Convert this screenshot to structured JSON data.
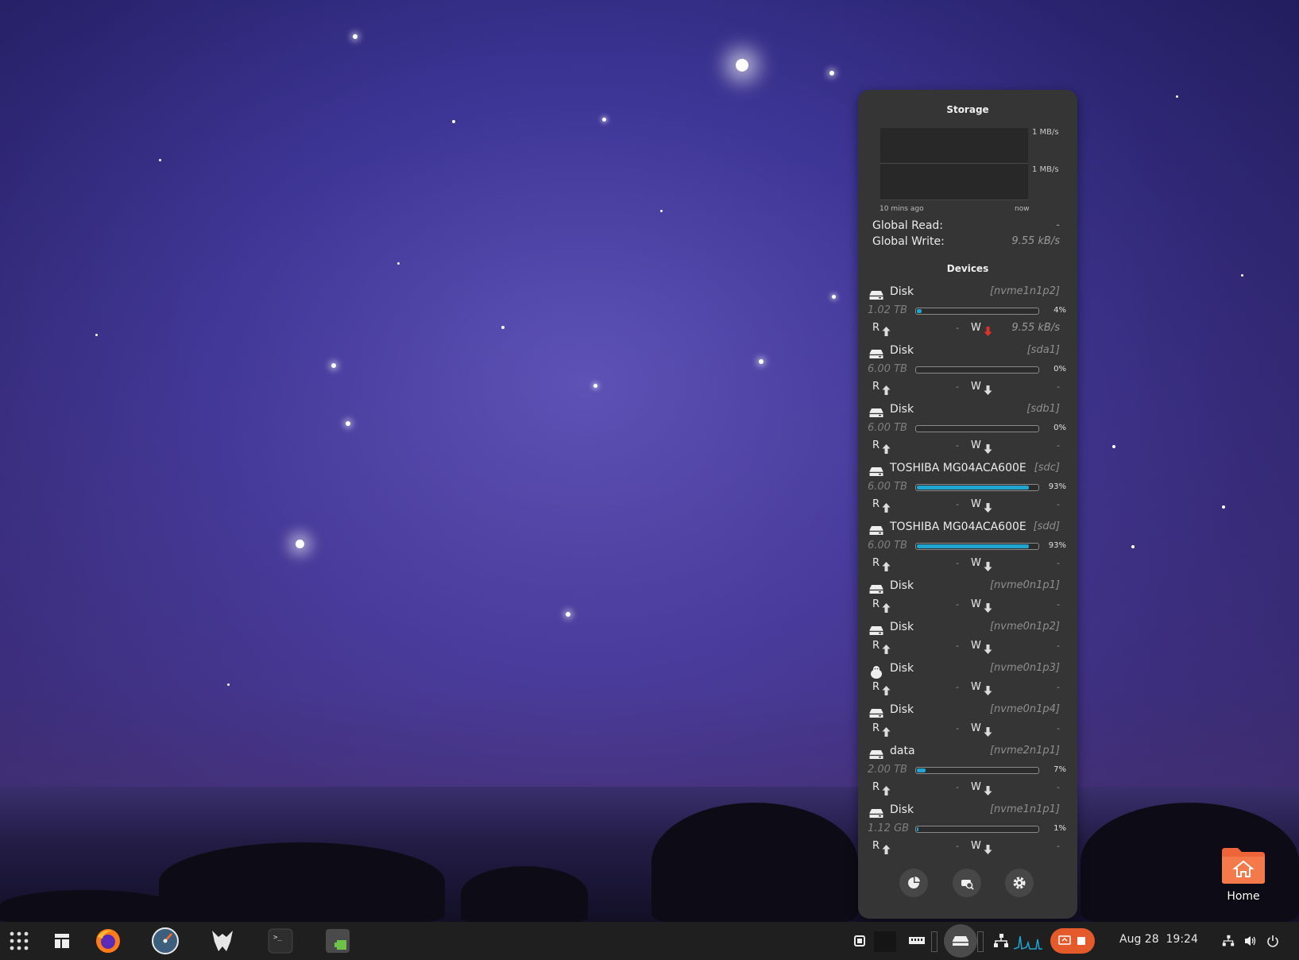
{
  "storage": {
    "title": "Storage",
    "graph_scale_top": "1 MB/s",
    "graph_scale_bottom": "1 MB/s",
    "graph_time_start": "10 mins ago",
    "graph_time_end": "now",
    "global_read_label": "Global Read:",
    "global_read_value": "-",
    "global_write_label": "Global Write:",
    "global_write_value": "9.55 kB/s",
    "devices_title": "Devices",
    "read_label": "R",
    "write_label": "W",
    "devices": [
      {
        "name": "Disk",
        "id": "[nvme1n1p2]",
        "size": "1.02 TB",
        "percent": "4%",
        "usage": 0.04,
        "read": "-",
        "write": "9.55 kB/s",
        "write_active": true
      },
      {
        "name": "Disk",
        "id": "[sda1]",
        "size": "6.00 TB",
        "percent": "0%",
        "usage": 0.0,
        "read": "-",
        "write": "-"
      },
      {
        "name": "Disk",
        "id": "[sdb1]",
        "size": "6.00 TB",
        "percent": "0%",
        "usage": 0.0,
        "read": "-",
        "write": "-"
      },
      {
        "name": "TOSHIBA MG04ACA600E",
        "id": "[sdc]",
        "size": "6.00 TB",
        "percent": "93%",
        "usage": 0.93,
        "read": "-",
        "write": "-"
      },
      {
        "name": "TOSHIBA MG04ACA600E",
        "id": "[sdd]",
        "size": "6.00 TB",
        "percent": "93%",
        "usage": 0.93,
        "read": "-",
        "write": "-"
      },
      {
        "name": "Disk",
        "id": "[nvme0n1p1]",
        "read": "-",
        "write": "-"
      },
      {
        "name": "Disk",
        "id": "[nvme0n1p2]",
        "read": "-",
        "write": "-"
      },
      {
        "name": "Disk",
        "id": "[nvme0n1p3]",
        "read": "-",
        "write": "-",
        "icon": "linux-icon"
      },
      {
        "name": "Disk",
        "id": "[nvme0n1p4]",
        "read": "-",
        "write": "-"
      },
      {
        "name": "data",
        "id": "[nvme2n1p1]",
        "size": "2.00 TB",
        "percent": "7%",
        "usage": 0.07,
        "read": "-",
        "write": "-"
      },
      {
        "name": "Disk",
        "id": "[nvme1n1p1]",
        "size": "1.12 GB",
        "percent": "1%",
        "usage": 0.01,
        "read": "-",
        "write": "-"
      }
    ]
  },
  "taskbar": {
    "date": "Aug 28",
    "time": "19:24"
  },
  "desktop": {
    "home_label": "Home"
  },
  "colors": {
    "accent": "#1fa5cf",
    "write_active": "#e0322a",
    "recording": "#e55a2b",
    "folder": "#f0643a"
  }
}
